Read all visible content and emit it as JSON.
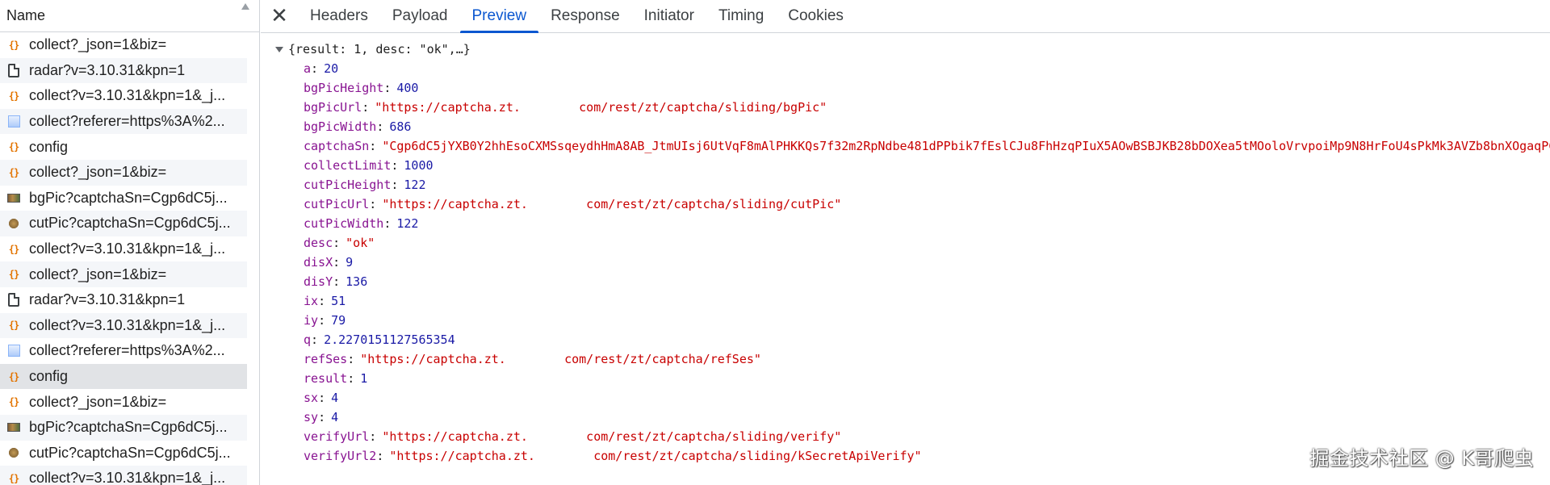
{
  "request_list": {
    "header": "Name",
    "items": [
      {
        "icon": "json",
        "label": "collect?_json=1&biz="
      },
      {
        "icon": "doc",
        "label": "radar?v=3.10.31&kpn=1"
      },
      {
        "icon": "json",
        "label": "collect?v=3.10.31&kpn=1&_j..."
      },
      {
        "icon": "img",
        "label": "collect?referer=https%3A%2..."
      },
      {
        "icon": "json",
        "label": "config"
      },
      {
        "icon": "json",
        "label": "collect?_json=1&biz="
      },
      {
        "icon": "bg",
        "label": "bgPic?captchaSn=Cgp6dC5j..."
      },
      {
        "icon": "cut",
        "label": "cutPic?captchaSn=Cgp6dC5j..."
      },
      {
        "icon": "json",
        "label": "collect?v=3.10.31&kpn=1&_j..."
      },
      {
        "icon": "json",
        "label": "collect?_json=1&biz="
      },
      {
        "icon": "doc",
        "label": "radar?v=3.10.31&kpn=1"
      },
      {
        "icon": "json",
        "label": "collect?v=3.10.31&kpn=1&_j..."
      },
      {
        "icon": "img",
        "label": "collect?referer=https%3A%2..."
      },
      {
        "icon": "json",
        "label": "config",
        "selected": true
      },
      {
        "icon": "json",
        "label": "collect?_json=1&biz="
      },
      {
        "icon": "bg",
        "label": "bgPic?captchaSn=Cgp6dC5j..."
      },
      {
        "icon": "cut",
        "label": "cutPic?captchaSn=Cgp6dC5j..."
      },
      {
        "icon": "json",
        "label": "collect?v=3.10.31&kpn=1&_j..."
      }
    ]
  },
  "tabs": {
    "close_label": "✕",
    "items": [
      "Headers",
      "Payload",
      "Preview",
      "Response",
      "Initiator",
      "Timing",
      "Cookies"
    ],
    "active": "Preview"
  },
  "preview": {
    "summary": "{result: 1, desc: \"ok\",…}",
    "properties": [
      {
        "key": "a",
        "value": "20",
        "type": "number"
      },
      {
        "key": "bgPicHeight",
        "value": "400",
        "type": "number"
      },
      {
        "key": "bgPicUrl",
        "value": "\"https://captcha.zt.        com/rest/zt/captcha/sliding/bgPic\"",
        "type": "string"
      },
      {
        "key": "bgPicWidth",
        "value": "686",
        "type": "number"
      },
      {
        "key": "captchaSn",
        "value": "\"Cgp6dC5jYXB0Y2hhEsoCXMSsqeydhHmA8AB_JtmUIsj6UtVqF8mAlPHKKQs7f32m2RpNdbe481dPPbik7fEslCJu8FhHzqPIuX5AOwBSBJKB28bDOXea5tMOoloVrvpoiMp9N8HrFoU4sPkMk3AVZb8bnXOgaqPC",
        "type": "string"
      },
      {
        "key": "collectLimit",
        "value": "1000",
        "type": "number"
      },
      {
        "key": "cutPicHeight",
        "value": "122",
        "type": "number"
      },
      {
        "key": "cutPicUrl",
        "value": "\"https://captcha.zt.        com/rest/zt/captcha/sliding/cutPic\"",
        "type": "string"
      },
      {
        "key": "cutPicWidth",
        "value": "122",
        "type": "number"
      },
      {
        "key": "desc",
        "value": "\"ok\"",
        "type": "string"
      },
      {
        "key": "disX",
        "value": "9",
        "type": "number"
      },
      {
        "key": "disY",
        "value": "136",
        "type": "number"
      },
      {
        "key": "ix",
        "value": "51",
        "type": "number"
      },
      {
        "key": "iy",
        "value": "79",
        "type": "number"
      },
      {
        "key": "q",
        "value": "2.2270151127565354",
        "type": "number"
      },
      {
        "key": "refSes",
        "value": "\"https://captcha.zt.        com/rest/zt/captcha/refSes\"",
        "type": "string"
      },
      {
        "key": "result",
        "value": "1",
        "type": "number"
      },
      {
        "key": "sx",
        "value": "4",
        "type": "number"
      },
      {
        "key": "sy",
        "value": "4",
        "type": "number"
      },
      {
        "key": "verifyUrl",
        "value": "\"https://captcha.zt.        com/rest/zt/captcha/sliding/verify\"",
        "type": "string"
      },
      {
        "key": "verifyUrl2",
        "value": "\"https://captcha.zt.        com/rest/zt/captcha/sliding/kSecretApiVerify\"",
        "type": "string"
      }
    ]
  },
  "watermark": "掘金技术社区 @ K哥爬虫",
  "colors": {
    "accent": "#0b57d0",
    "key": "#881391",
    "number": "#1a1aa6",
    "string": "#c80000"
  }
}
